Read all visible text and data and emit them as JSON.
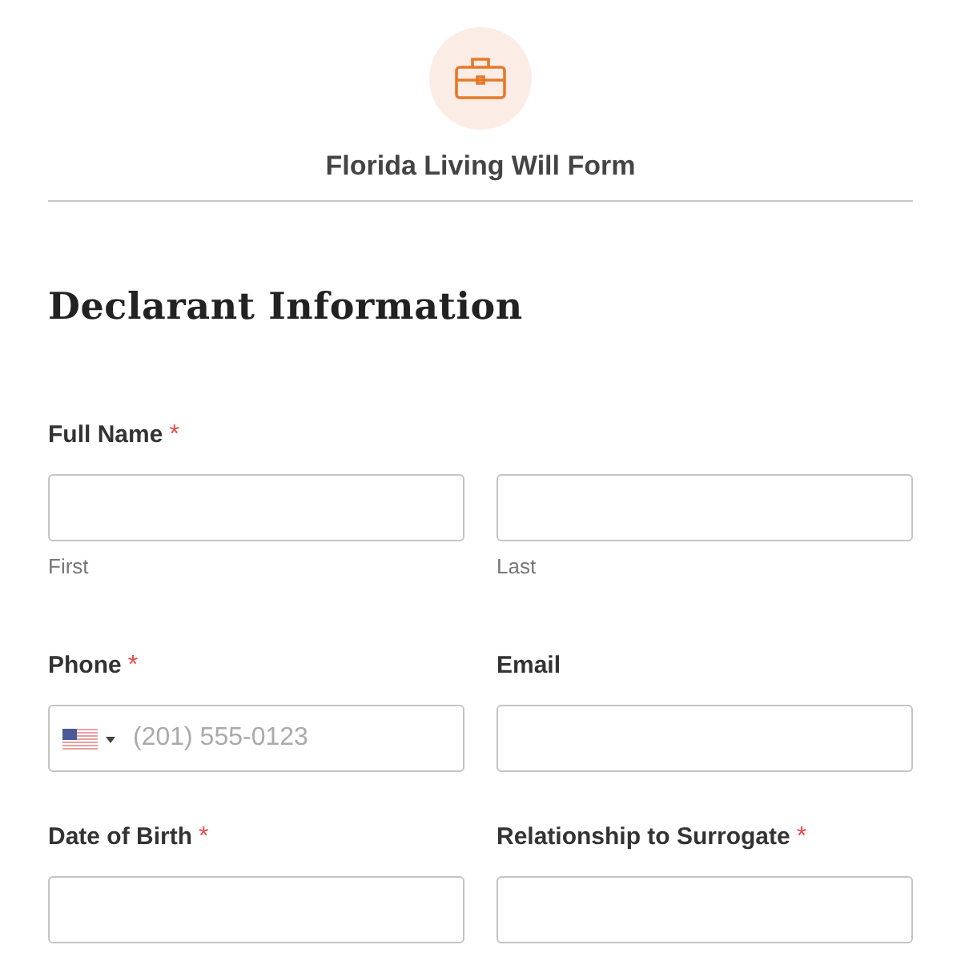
{
  "header": {
    "title": "Florida Living Will Form"
  },
  "section": {
    "heading": "Declarant Information"
  },
  "rows": [
    {
      "fields": [
        {
          "kind": "name",
          "label": "Full Name",
          "required_mark": "*",
          "parts": [
            {
              "sublabel": "First"
            },
            {
              "sublabel": "Last"
            }
          ]
        }
      ]
    },
    {
      "fields": [
        {
          "kind": "phone",
          "label": "Phone",
          "required_mark": "*",
          "placeholder": "(201) 555-0123"
        },
        {
          "kind": "text",
          "label": "Email"
        }
      ]
    },
    {
      "fields": [
        {
          "kind": "text",
          "label": "Date of Birth",
          "required_mark": "*"
        },
        {
          "kind": "text",
          "label": "Relationship to Surrogate",
          "required_mark": "*"
        }
      ]
    }
  ]
}
